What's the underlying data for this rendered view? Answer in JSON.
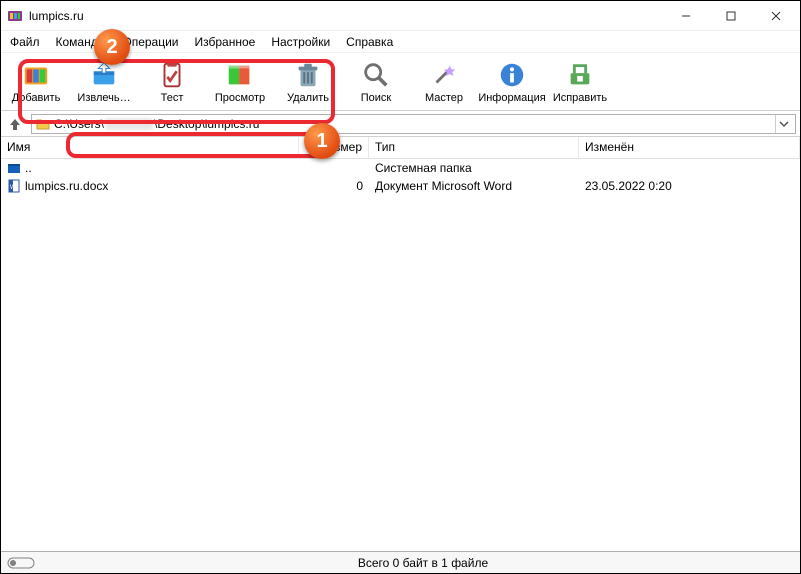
{
  "title": "lumpics.ru",
  "menu": [
    "Файл",
    "Команды",
    "Операции",
    "Избранное",
    "Настройки",
    "Справка"
  ],
  "toolbar": [
    {
      "label": "Добавить",
      "id": "add"
    },
    {
      "label": "Извлечь…",
      "id": "extract"
    },
    {
      "label": "Тест",
      "id": "test"
    },
    {
      "label": "Просмотр",
      "id": "view"
    },
    {
      "label": "Удалить",
      "id": "delete"
    },
    {
      "label": "Поиск",
      "id": "find"
    },
    {
      "label": "Мастер",
      "id": "wizard"
    },
    {
      "label": "Информация",
      "id": "info"
    },
    {
      "label": "Исправить",
      "id": "repair"
    }
  ],
  "address": {
    "prefix": "C:\\Users\\",
    "suffix": "\\Desktop\\lumpics.ru"
  },
  "columns": {
    "name": "Имя",
    "size": "Размер",
    "type": "Тип",
    "modified": "Изменён"
  },
  "rows": [
    {
      "name": "..",
      "size": "",
      "type": "Системная папка",
      "modified": "",
      "icon": "folder-up"
    },
    {
      "name": "lumpics.ru.docx",
      "size": "0",
      "type": "Документ Microsoft Word",
      "modified": "23.05.2022 0:20",
      "icon": "docx"
    }
  ],
  "status": "Всего 0 байт в 1 файле",
  "callouts": {
    "one": "1",
    "two": "2"
  }
}
